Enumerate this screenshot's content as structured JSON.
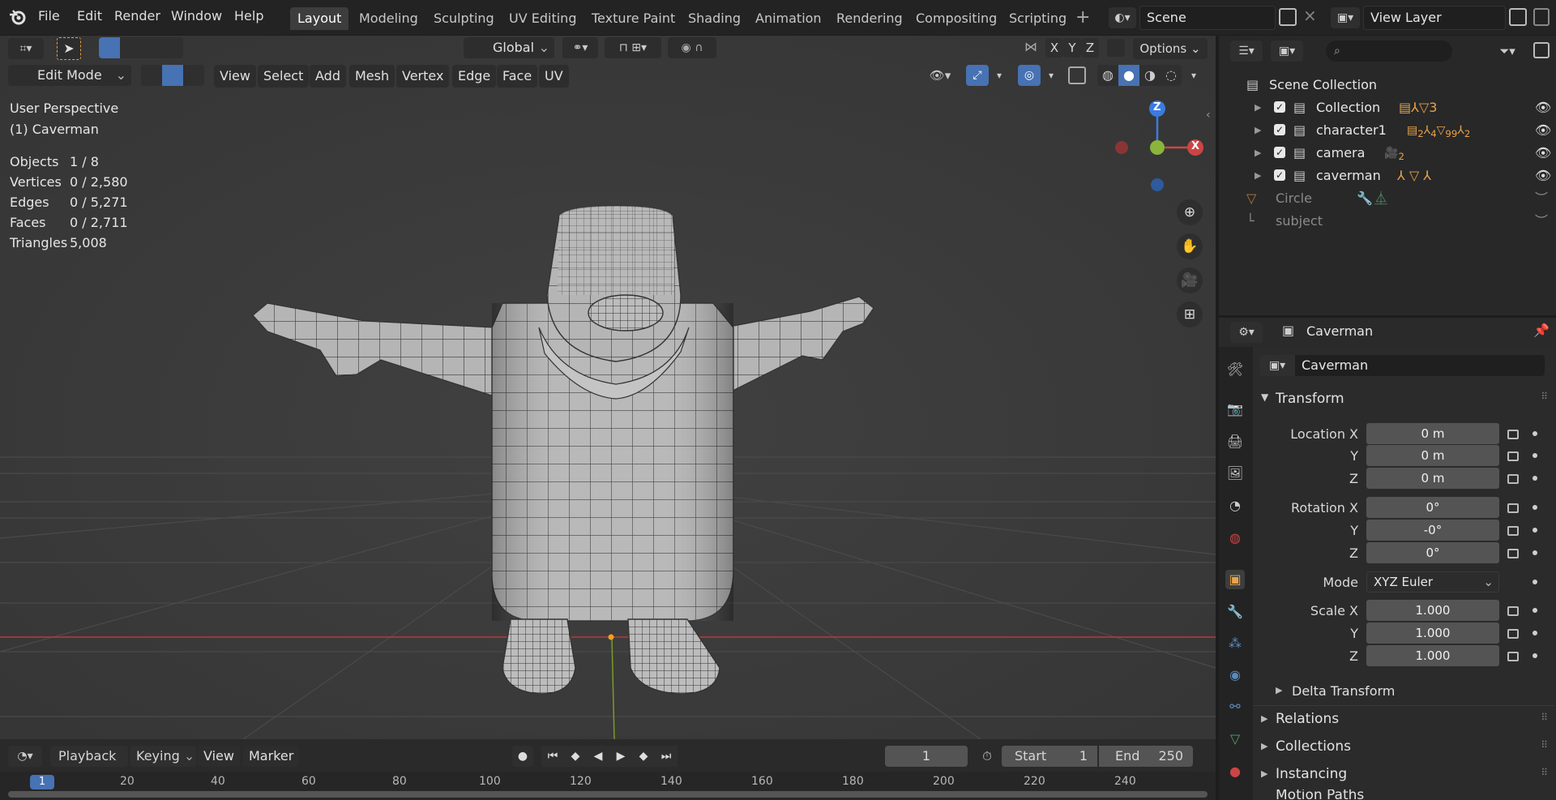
{
  "menubar": {
    "items": [
      "File",
      "Edit",
      "Render",
      "Window",
      "Help"
    ],
    "workspaces": [
      "Layout",
      "Modeling",
      "Sculpting",
      "UV Editing",
      "Texture Paint",
      "Shading",
      "Animation",
      "Rendering",
      "Compositing",
      "Scripting"
    ],
    "active_workspace": "Layout",
    "scene": "Scene",
    "view_layer": "View Layer"
  },
  "tool_header": {
    "transform_orientation": "Global",
    "axis_buttons": [
      "X",
      "Y",
      "Z"
    ],
    "options_label": "Options"
  },
  "viewport_header": {
    "mode": "Edit Mode",
    "menus": [
      "View",
      "Select",
      "Add",
      "Mesh",
      "Vertex",
      "Edge",
      "Face",
      "UV"
    ]
  },
  "overlay_text": {
    "perspective": "User Perspective",
    "object": "(1) Caverman",
    "stats": [
      {
        "label": "Objects",
        "value": "1 / 8"
      },
      {
        "label": "Vertices",
        "value": "0 / 2,580"
      },
      {
        "label": "Edges",
        "value": "0 / 5,271"
      },
      {
        "label": "Faces",
        "value": "0 / 2,711"
      },
      {
        "label": "Triangles",
        "value": "5,008"
      }
    ]
  },
  "gizmo": {
    "z": "Z",
    "x": "X"
  },
  "timeline": {
    "menus": [
      "Playback",
      "Keying",
      "View",
      "Marker"
    ],
    "current_frame": "1",
    "start_label": "Start",
    "start": "1",
    "end_label": "End",
    "end": "250",
    "ruler_ticks": [
      "1",
      "20",
      "40",
      "60",
      "80",
      "100",
      "120",
      "140",
      "160",
      "180",
      "200",
      "220",
      "240"
    ]
  },
  "outliner": {
    "root": "Scene Collection",
    "rows": [
      {
        "name": "Collection",
        "checked": true
      },
      {
        "name": "character1",
        "checked": true
      },
      {
        "name": "camera",
        "checked": true
      },
      {
        "name": "caverman",
        "checked": true
      },
      {
        "name": "Circle",
        "checked": false
      },
      {
        "name": "subject",
        "checked": false
      }
    ],
    "badges": {
      "collection": "3",
      "character1": [
        "2",
        "4",
        "99",
        "2"
      ],
      "camera": "2"
    }
  },
  "properties": {
    "object_name_header": "Caverman",
    "object_name_field": "Caverman",
    "transform_title": "Transform",
    "location_label": "Location X",
    "location": [
      "0 m",
      "0 m",
      "0 m"
    ],
    "rotation_label": "Rotation X",
    "rotation": [
      "0°",
      "-0°",
      "0°"
    ],
    "mode_label": "Mode",
    "mode_value": "XYZ Euler",
    "scale_label": "Scale X",
    "scale": [
      "1.000",
      "1.000",
      "1.000"
    ],
    "y_label": "Y",
    "z_label": "Z",
    "delta_transform": "Delta Transform",
    "sections": [
      "Relations",
      "Collections",
      "Instancing",
      "Motion Paths"
    ]
  },
  "colors": {
    "accent_blue": "#4772b3",
    "orange": "#e8a24a",
    "axis_red": "#cc4545",
    "axis_green": "#8ab43a",
    "axis_blue": "#3b7be0"
  }
}
